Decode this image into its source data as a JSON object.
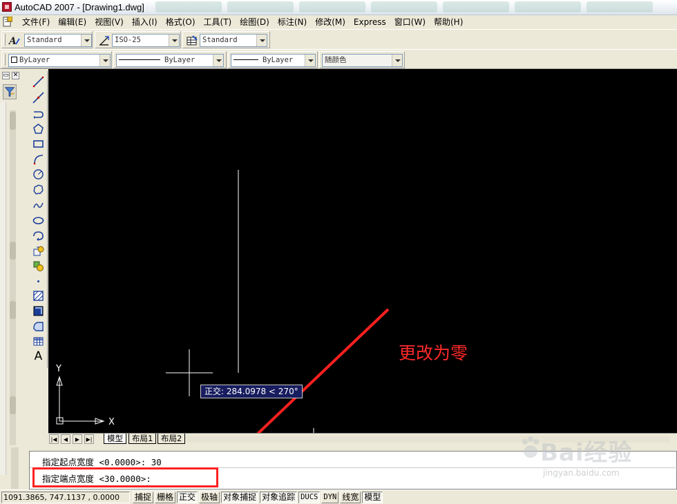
{
  "window": {
    "title": "AutoCAD 2007 - [Drawing1.dwg]"
  },
  "menu": {
    "items": [
      "文件(F)",
      "编辑(E)",
      "视图(V)",
      "插入(I)",
      "格式(O)",
      "工具(T)",
      "绘图(D)",
      "标注(N)",
      "修改(M)",
      "Express",
      "窗口(W)",
      "帮助(H)"
    ]
  },
  "styles_toolbar": {
    "text_style": "Standard",
    "dim_style": "ISO-25",
    "table_style": "Standard"
  },
  "properties_toolbar": {
    "layer": "ByLayer",
    "linetype": "ByLayer",
    "lineweight": "ByLayer",
    "color": "随颜色"
  },
  "left_panel": {
    "minimize_glyph": "▭",
    "close_glyph": "✕"
  },
  "draw_toolbar": {
    "icons": [
      "line-icon",
      "construction-line-icon",
      "polyline-icon",
      "polygon-icon",
      "rectangle-icon",
      "arc-icon",
      "circle-icon",
      "revision-cloud-icon",
      "spline-icon",
      "ellipse-icon",
      "ellipse-arc-icon",
      "insert-block-icon",
      "make-block-icon",
      "point-icon",
      "hatch-icon",
      "gradient-icon",
      "region-icon",
      "table-icon",
      "multiline-text-icon"
    ],
    "text_tool_label": "A"
  },
  "canvas": {
    "background": "#000000",
    "ucs_x_label": "X",
    "ucs_y_label": "Y",
    "tooltip": "正交: 284.0978 < 270°",
    "annotation": "更改为零",
    "annotation_color": "#ff2a2a",
    "arrow_color": "#ff2020"
  },
  "layout_tabs": {
    "nav": [
      "|◀",
      "◀",
      "▶",
      "▶|"
    ],
    "tabs": [
      "模型",
      "布局1",
      "布局2"
    ],
    "active": "模型"
  },
  "command": {
    "history_line": "指定起点宽度 <0.0000>: 30",
    "prompt_line": "指定端点宽度 <30.0000>:"
  },
  "status": {
    "coordinates": "1091.3865, 747.1137 , 0.0000",
    "toggles": [
      "捕捉",
      "栅格",
      "正交",
      "极轴",
      "对象捕捉",
      "对象追踪",
      "DUCS",
      "DYN",
      "线宽",
      "模型"
    ],
    "pressed": [
      "正交",
      "对象捕捉",
      "对象追踪",
      "DUCS",
      "模型"
    ]
  },
  "watermark": {
    "brand": "Bai经验",
    "url": "jingyan.baidu.com"
  }
}
